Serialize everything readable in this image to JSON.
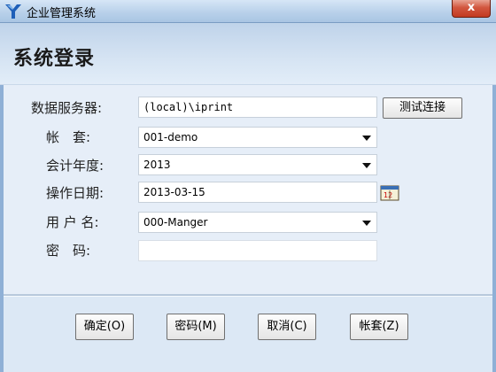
{
  "window": {
    "title": "企业管理系统",
    "close_symbol": "x"
  },
  "header": {
    "title": "系统登录"
  },
  "form": {
    "server": {
      "label": "数据服务器:",
      "value": "(local)\\iprint",
      "test_button": "测试连接"
    },
    "account": {
      "label": "帐　套:",
      "value": "001-demo"
    },
    "year": {
      "label": "会计年度:",
      "value": "2013"
    },
    "date": {
      "label": "操作日期:",
      "value": "2013-03-15",
      "icon": "calendar-icon"
    },
    "user": {
      "label": "用 户 名:",
      "value": "000-Manger"
    },
    "password": {
      "label": "密　码:",
      "value": ""
    }
  },
  "footer": {
    "ok": "确定(O)",
    "password": "密码(M)",
    "cancel": "取消(C)",
    "account_set": "帐套(Z)"
  },
  "colors": {
    "titlebar": "#b9d1ea",
    "close": "#c23a21",
    "background": "#e6eef8"
  }
}
